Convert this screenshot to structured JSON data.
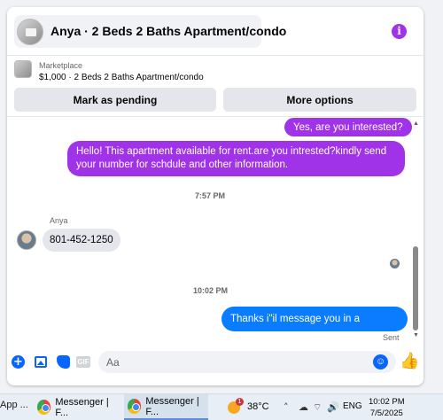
{
  "header": {
    "title": "Anya · 2 Beds 2 Baths Apartment/condo"
  },
  "marketplace": {
    "label": "Marketplace",
    "listing": "$1,000 · 2 Beds 2 Baths Apartment/condo",
    "mark_pending_label": "Mark as pending",
    "more_options_label": "More options"
  },
  "messages": [
    {
      "direction": "outgoing",
      "text": "Yes, are you interested?",
      "color": "#a032e8"
    },
    {
      "direction": "outgoing",
      "text": "Hello! This apartment available for rent.are you intrested?kindly send your number for schdule and other information.",
      "color": "#a032e8"
    },
    {
      "direction": "incoming",
      "sender": "Anya",
      "text": "801-452-1250"
    },
    {
      "direction": "outgoing",
      "text": "Thanks i\"il message you in a moment",
      "color": "#0a7cff"
    }
  ],
  "timestamps": [
    "7:57 PM",
    "10:02 PM"
  ],
  "status": {
    "sent": "Sent"
  },
  "composer": {
    "placeholder": "Aa",
    "icons": [
      "plus-circle-icon",
      "photo-icon",
      "sticker-icon",
      "gif-icon",
      "emoji-icon",
      "like-icon"
    ],
    "gif_label": "GIF"
  },
  "taskbar": {
    "app_fragment": "App ...",
    "windows": [
      {
        "label": "Messenger | F...",
        "active": false
      },
      {
        "label": "Messenger | F...",
        "active": true
      }
    ],
    "weather_badge": "1",
    "temperature": "38°C",
    "language": "ENG",
    "time": "10:02 PM",
    "date": "7/5/2025"
  },
  "colors": {
    "accent_purple": "#a032e8",
    "messenger_blue": "#0866ff",
    "sent_blue": "#0a7cff"
  }
}
